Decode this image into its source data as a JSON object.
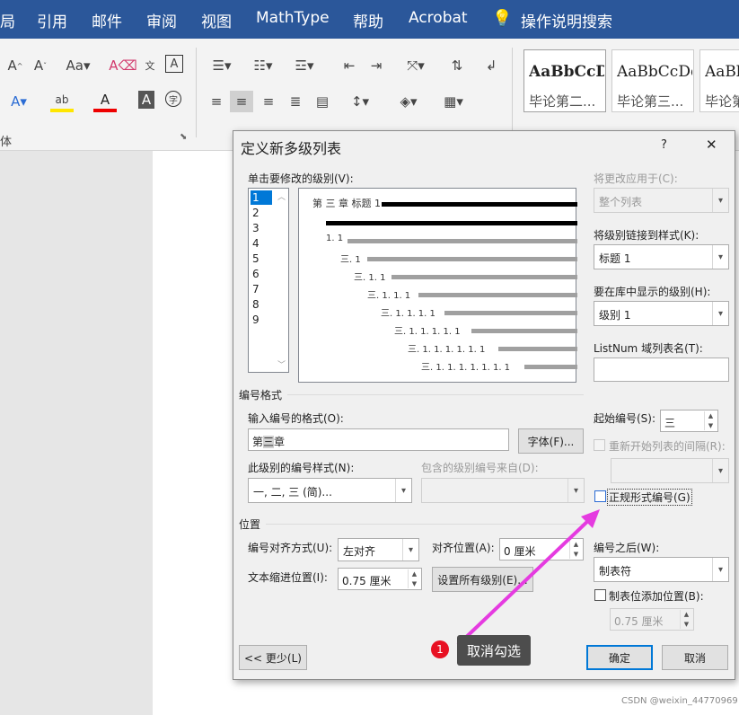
{
  "ribbon_tabs": [
    "局",
    "引用",
    "邮件",
    "审阅",
    "视图",
    "MathType",
    "帮助",
    "Acrobat",
    "操作说明搜索"
  ],
  "ribbon": {
    "font_group_label": "体",
    "styles": [
      {
        "sample": "AaBbCcDd",
        "name": "毕论第二..."
      },
      {
        "sample": "AaBbCcDd",
        "name": "毕论第三..."
      },
      {
        "sample": "AaBb",
        "name": "毕论第"
      }
    ]
  },
  "dialog": {
    "title": "定义新多级列表",
    "help": "?",
    "close": "✕",
    "click_level_label": "单击要修改的级别(V):",
    "levels": [
      "1",
      "2",
      "3",
      "4",
      "5",
      "6",
      "7",
      "8",
      "9"
    ],
    "selected_level": "1",
    "preview": {
      "lines": [
        "第 三 章  标题 1",
        "1. 1",
        "三. 1",
        "三. 1. 1",
        "三. 1. 1. 1",
        "三. 1. 1. 1. 1",
        "三. 1. 1. 1. 1. 1",
        "三. 1. 1. 1. 1. 1. 1",
        "三. 1. 1. 1. 1. 1. 1. 1"
      ]
    },
    "apply_to_label": "将更改应用于(C):",
    "apply_to_value": "整个列表",
    "link_style_label": "将级别链接到样式(K):",
    "link_style_value": "标题 1",
    "gallery_level_label": "要在库中显示的级别(H):",
    "gallery_level_value": "级别 1",
    "listnum_label": "ListNum 域列表名(T):",
    "listnum_value": "",
    "number_format_section": "编号格式",
    "enter_format_label": "输入编号的格式(O):",
    "format_prefix": "第",
    "format_number": "三",
    "format_suffix": "章",
    "font_button": "字体(F)...",
    "number_style_label": "此级别的编号样式(N):",
    "number_style_value": "一, 二, 三 (简)...",
    "include_level_label": "包含的级别编号来自(D):",
    "start_at_label": "起始编号(S):",
    "start_at_value": "三",
    "restart_label": "重新开始列表的间隔(R):",
    "legal_label": "正规形式编号(G)",
    "position_section": "位置",
    "alignment_label": "编号对齐方式(U):",
    "alignment_value": "左对齐",
    "align_at_label": "对齐位置(A):",
    "align_at_value": "0 厘米",
    "follow_label": "编号之后(W):",
    "follow_value": "制表符",
    "indent_label": "文本缩进位置(I):",
    "indent_value": "0.75 厘米",
    "set_all_button": "设置所有级别(E)...",
    "tab_stop_label": "制表位添加位置(B):",
    "tab_stop_value": "0.75 厘米",
    "less_button": "<< 更少(L)",
    "ok_button": "确定",
    "cancel_button": "取消"
  },
  "callout": {
    "number": "1",
    "text": "取消勾选",
    "arrow_color": "#e53be0"
  },
  "watermark": "CSDN @weixin_44770969",
  "colors": {
    "ribbon_tab_bg": "#2b579a",
    "selection": "#0078d7",
    "callout_bg": "#4d4d4d",
    "badge": "#e81123"
  }
}
